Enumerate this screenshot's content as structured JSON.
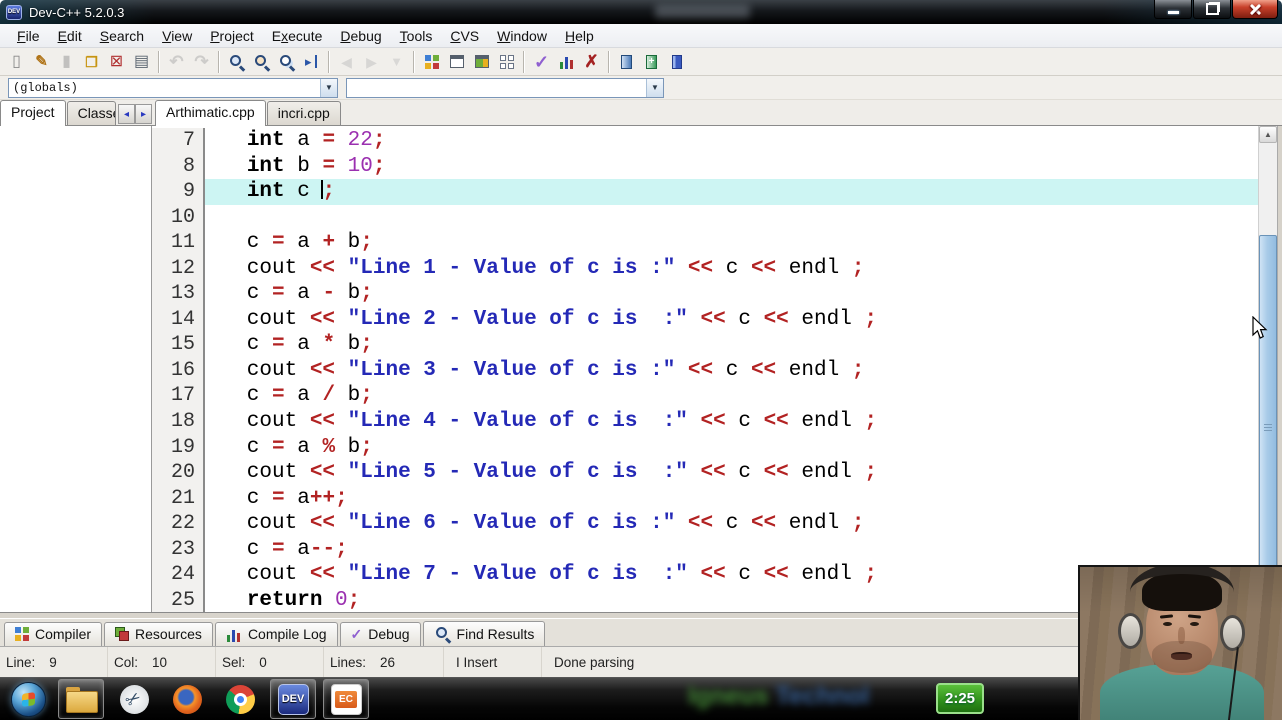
{
  "window": {
    "title": "Dev-C++ 5.2.0.3",
    "app_icon_label": "DEV"
  },
  "menu": {
    "items": [
      {
        "label": "File",
        "u": 0
      },
      {
        "label": "Edit",
        "u": 0
      },
      {
        "label": "Search",
        "u": 0
      },
      {
        "label": "View",
        "u": 0
      },
      {
        "label": "Project",
        "u": 0
      },
      {
        "label": "Execute",
        "u": 1
      },
      {
        "label": "Debug",
        "u": 0
      },
      {
        "label": "Tools",
        "u": 0
      },
      {
        "label": "CVS",
        "u": 0
      },
      {
        "label": "Window",
        "u": 0
      },
      {
        "label": "Help",
        "u": 0
      }
    ]
  },
  "toolbar": {
    "groups": [
      [
        {
          "name": "new-file",
          "kind": "page-new"
        },
        {
          "name": "open-file",
          "kind": "page-open"
        },
        {
          "name": "save-file",
          "kind": "page-save",
          "disabled": true
        },
        {
          "name": "save-all",
          "kind": "pages-all"
        },
        {
          "name": "close-file",
          "kind": "page-close"
        },
        {
          "name": "print",
          "kind": "printer"
        }
      ],
      [
        {
          "name": "undo",
          "kind": "undo",
          "disabled": true
        },
        {
          "name": "redo",
          "kind": "redo",
          "disabled": true
        }
      ],
      [
        {
          "name": "find",
          "kind": "mag"
        },
        {
          "name": "replace",
          "kind": "mag-replace"
        },
        {
          "name": "find-in-files",
          "kind": "mag-files"
        },
        {
          "name": "goto-line",
          "kind": "goto"
        }
      ],
      [
        {
          "name": "back",
          "kind": "nav-back",
          "disabled": true
        },
        {
          "name": "forward",
          "kind": "nav-forward",
          "disabled": true
        },
        {
          "name": "bookmark",
          "kind": "flag",
          "disabled": true
        }
      ],
      [
        {
          "name": "new-project",
          "kind": "grid-color"
        },
        {
          "name": "new-window",
          "kind": "win-plain"
        },
        {
          "name": "project-options",
          "kind": "win-color"
        },
        {
          "name": "window-grid",
          "kind": "grid-outline"
        }
      ],
      [
        {
          "name": "compile",
          "kind": "check"
        },
        {
          "name": "run",
          "kind": "bars"
        },
        {
          "name": "abort-compile",
          "kind": "cross"
        }
      ],
      [
        {
          "name": "compile-and-run",
          "kind": "door-blue"
        },
        {
          "name": "rebuild-all",
          "kind": "door-green"
        },
        {
          "name": "debug-window",
          "kind": "book-blue"
        }
      ]
    ]
  },
  "navigator": {
    "combo1": "(globals)",
    "combo2": ""
  },
  "left_tabs": {
    "items": [
      "Project",
      "Classes"
    ],
    "active": 0
  },
  "editor_tabs": {
    "items": [
      "Arthimatic.cpp",
      "incri.cpp"
    ],
    "active": 0
  },
  "code": {
    "lines": [
      {
        "n": "7",
        "t": [
          [
            "p",
            "   "
          ],
          [
            "k",
            "int"
          ],
          [
            "p",
            " a "
          ],
          [
            "o",
            "="
          ],
          [
            "p",
            " "
          ],
          [
            "n",
            "22"
          ],
          [
            "o",
            ";"
          ]
        ]
      },
      {
        "n": "8",
        "t": [
          [
            "p",
            "   "
          ],
          [
            "k",
            "int"
          ],
          [
            "p",
            " b "
          ],
          [
            "o",
            "="
          ],
          [
            "p",
            " "
          ],
          [
            "n",
            "10"
          ],
          [
            "o",
            ";"
          ]
        ]
      },
      {
        "n": "9",
        "hl": true,
        "t": [
          [
            "p",
            "   "
          ],
          [
            "k",
            "int"
          ],
          [
            "p",
            " c "
          ],
          [
            "cur",
            ""
          ],
          [
            "o",
            ";"
          ]
        ]
      },
      {
        "n": "10",
        "t": []
      },
      {
        "n": "11",
        "t": [
          [
            "p",
            "   c "
          ],
          [
            "o",
            "="
          ],
          [
            "p",
            " a "
          ],
          [
            "o",
            "+"
          ],
          [
            "p",
            " b"
          ],
          [
            "o",
            ";"
          ]
        ]
      },
      {
        "n": "12",
        "t": [
          [
            "p",
            "   cout "
          ],
          [
            "o",
            "<<"
          ],
          [
            "p",
            " "
          ],
          [
            "s",
            "\"Line 1 - Value of c is :\""
          ],
          [
            "p",
            " "
          ],
          [
            "o",
            "<<"
          ],
          [
            "p",
            " c "
          ],
          [
            "o",
            "<<"
          ],
          [
            "p",
            " endl "
          ],
          [
            "o",
            ";"
          ]
        ]
      },
      {
        "n": "13",
        "t": [
          [
            "p",
            "   c "
          ],
          [
            "o",
            "="
          ],
          [
            "p",
            " a "
          ],
          [
            "o",
            "-"
          ],
          [
            "p",
            " b"
          ],
          [
            "o",
            ";"
          ]
        ]
      },
      {
        "n": "14",
        "t": [
          [
            "p",
            "   cout "
          ],
          [
            "o",
            "<<"
          ],
          [
            "p",
            " "
          ],
          [
            "s",
            "\"Line 2 - Value of c is  :\""
          ],
          [
            "p",
            " "
          ],
          [
            "o",
            "<<"
          ],
          [
            "p",
            " c "
          ],
          [
            "o",
            "<<"
          ],
          [
            "p",
            " endl "
          ],
          [
            "o",
            ";"
          ]
        ]
      },
      {
        "n": "15",
        "t": [
          [
            "p",
            "   c "
          ],
          [
            "o",
            "="
          ],
          [
            "p",
            " a "
          ],
          [
            "o",
            "*"
          ],
          [
            "p",
            " b"
          ],
          [
            "o",
            ";"
          ]
        ]
      },
      {
        "n": "16",
        "t": [
          [
            "p",
            "   cout "
          ],
          [
            "o",
            "<<"
          ],
          [
            "p",
            " "
          ],
          [
            "s",
            "\"Line 3 - Value of c is :\""
          ],
          [
            "p",
            " "
          ],
          [
            "o",
            "<<"
          ],
          [
            "p",
            " c "
          ],
          [
            "o",
            "<<"
          ],
          [
            "p",
            " endl "
          ],
          [
            "o",
            ";"
          ]
        ]
      },
      {
        "n": "17",
        "t": [
          [
            "p",
            "   c "
          ],
          [
            "o",
            "="
          ],
          [
            "p",
            " a "
          ],
          [
            "o",
            "/"
          ],
          [
            "p",
            " b"
          ],
          [
            "o",
            ";"
          ]
        ]
      },
      {
        "n": "18",
        "t": [
          [
            "p",
            "   cout "
          ],
          [
            "o",
            "<<"
          ],
          [
            "p",
            " "
          ],
          [
            "s",
            "\"Line 4 - Value of c is  :\""
          ],
          [
            "p",
            " "
          ],
          [
            "o",
            "<<"
          ],
          [
            "p",
            " c "
          ],
          [
            "o",
            "<<"
          ],
          [
            "p",
            " endl "
          ],
          [
            "o",
            ";"
          ]
        ]
      },
      {
        "n": "19",
        "t": [
          [
            "p",
            "   c "
          ],
          [
            "o",
            "="
          ],
          [
            "p",
            " a "
          ],
          [
            "o",
            "%"
          ],
          [
            "p",
            " b"
          ],
          [
            "o",
            ";"
          ]
        ]
      },
      {
        "n": "20",
        "t": [
          [
            "p",
            "   cout "
          ],
          [
            "o",
            "<<"
          ],
          [
            "p",
            " "
          ],
          [
            "s",
            "\"Line 5 - Value of c is  :\""
          ],
          [
            "p",
            " "
          ],
          [
            "o",
            "<<"
          ],
          [
            "p",
            " c "
          ],
          [
            "o",
            "<<"
          ],
          [
            "p",
            " endl "
          ],
          [
            "o",
            ";"
          ]
        ]
      },
      {
        "n": "21",
        "t": [
          [
            "p",
            "   c "
          ],
          [
            "o",
            "="
          ],
          [
            "p",
            " a"
          ],
          [
            "o",
            "++"
          ],
          [
            "o",
            ";"
          ]
        ]
      },
      {
        "n": "22",
        "t": [
          [
            "p",
            "   cout "
          ],
          [
            "o",
            "<<"
          ],
          [
            "p",
            " "
          ],
          [
            "s",
            "\"Line 6 - Value of c is :\""
          ],
          [
            "p",
            " "
          ],
          [
            "o",
            "<<"
          ],
          [
            "p",
            " c "
          ],
          [
            "o",
            "<<"
          ],
          [
            "p",
            " endl "
          ],
          [
            "o",
            ";"
          ]
        ]
      },
      {
        "n": "23",
        "t": [
          [
            "p",
            "   c "
          ],
          [
            "o",
            "="
          ],
          [
            "p",
            " a"
          ],
          [
            "o",
            "--"
          ],
          [
            "o",
            ";"
          ]
        ]
      },
      {
        "n": "24",
        "t": [
          [
            "p",
            "   cout "
          ],
          [
            "o",
            "<<"
          ],
          [
            "p",
            " "
          ],
          [
            "s",
            "\"Line 7 - Value of c is  :\""
          ],
          [
            "p",
            " "
          ],
          [
            "o",
            "<<"
          ],
          [
            "p",
            " c "
          ],
          [
            "o",
            "<<"
          ],
          [
            "p",
            " endl "
          ],
          [
            "o",
            ";"
          ]
        ]
      },
      {
        "n": "25",
        "t": [
          [
            "p",
            "   "
          ],
          [
            "k",
            "return"
          ],
          [
            "p",
            " "
          ],
          [
            "n",
            "0"
          ],
          [
            "o",
            ";"
          ]
        ]
      }
    ]
  },
  "report_tabs": {
    "items": [
      {
        "label": "Compiler",
        "icon": "grid-color"
      },
      {
        "label": "Resources",
        "icon": "layers"
      },
      {
        "label": "Compile Log",
        "icon": "bars"
      },
      {
        "label": "Debug",
        "icon": "check-sm"
      },
      {
        "label": "Find Results",
        "icon": "mag"
      }
    ]
  },
  "status_bar": {
    "fields": [
      {
        "label": "Line:",
        "value": "9"
      },
      {
        "label": "Col:",
        "value": "10"
      },
      {
        "label": "Sel:",
        "value": "0"
      },
      {
        "label": "Lines:",
        "value": "26"
      }
    ],
    "mode": "I Insert",
    "message": "Done parsing"
  },
  "taskbar": {
    "items": [
      {
        "name": "start-button",
        "icon": "start"
      },
      {
        "name": "file-explorer",
        "icon": "folder",
        "active": true
      },
      {
        "name": "snipping-tool",
        "icon": "scissors"
      },
      {
        "name": "firefox",
        "icon": "firefox"
      },
      {
        "name": "chrome",
        "icon": "chrome"
      },
      {
        "name": "dev-cpp",
        "icon": "devcpp",
        "label": "DEV",
        "active": true
      },
      {
        "name": "presentation-app",
        "icon": "ec",
        "label": "EC",
        "active": true
      }
    ],
    "watermark": {
      "part1": "Igneus ",
      "part2": "Technol"
    },
    "timer": "2:25"
  },
  "colors": {
    "line_highlight": "#cdf5f3",
    "operator": "#b22222",
    "number": "#9b30b0",
    "string": "#2429b6",
    "close_button": "#c0392b",
    "timer_green": "#2e8f1a"
  }
}
